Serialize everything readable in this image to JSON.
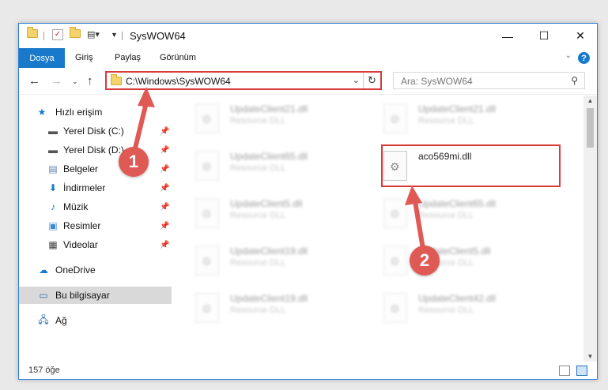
{
  "window": {
    "title": "SysWOW64",
    "controls": {
      "minimize": "—",
      "maximize": "☐",
      "close": "✕"
    }
  },
  "ribbon": {
    "tabs": [
      "Dosya",
      "Giriş",
      "Paylaş",
      "Görünüm"
    ],
    "help": "?"
  },
  "nav": {
    "address": "C:\\Windows\\SysWOW64",
    "search_placeholder": "Ara: SysWOW64"
  },
  "sidebar": {
    "quick_access": "Hızlı erişim",
    "items": [
      {
        "label": "Yerel Disk (C:)",
        "icon": "drive-icon",
        "pinned": true
      },
      {
        "label": "Yerel Disk (D:)",
        "icon": "drive-icon",
        "pinned": true
      },
      {
        "label": "Belgeler",
        "icon": "documents-icon",
        "pinned": true
      },
      {
        "label": "İndirmeler",
        "icon": "downloads-icon",
        "pinned": true
      },
      {
        "label": "Müzik",
        "icon": "music-icon",
        "pinned": true
      },
      {
        "label": "Resimler",
        "icon": "pictures-icon",
        "pinned": true
      },
      {
        "label": "Videolar",
        "icon": "videos-icon",
        "pinned": true
      }
    ],
    "onedrive": "OneDrive",
    "this_pc": "Bu bilgisayar",
    "network": "Ağ"
  },
  "files": {
    "left": [
      {
        "name": "UpdateClient21.dll",
        "type": "Resource DLL"
      },
      {
        "name": "UpdateClient65.dll",
        "type": "Resource DLL"
      },
      {
        "name": "UpdateClient5.dll",
        "type": "Resource DLL"
      },
      {
        "name": "UpdateClient19.dll",
        "type": "Resource DLL"
      },
      {
        "name": "UpdateClient19.dll",
        "type": "Resource DLL"
      }
    ],
    "right": [
      {
        "name": "UpdateClient21.dll",
        "type": "Resource DLL"
      },
      {
        "name": "aco569mi.dll",
        "type": ""
      },
      {
        "name": "UpdateClient65.dll",
        "type": "Resource DLL"
      },
      {
        "name": "UpdateClient5.dll",
        "type": "Resource DLL"
      },
      {
        "name": "UpdateClient42.dll",
        "type": "Resource DLL"
      }
    ]
  },
  "status": {
    "count": "157 öğe"
  },
  "callouts": [
    "1",
    "2"
  ],
  "colors": {
    "accent": "#1979ca",
    "highlight": "#d93a3a",
    "callout": "#e05a55"
  }
}
